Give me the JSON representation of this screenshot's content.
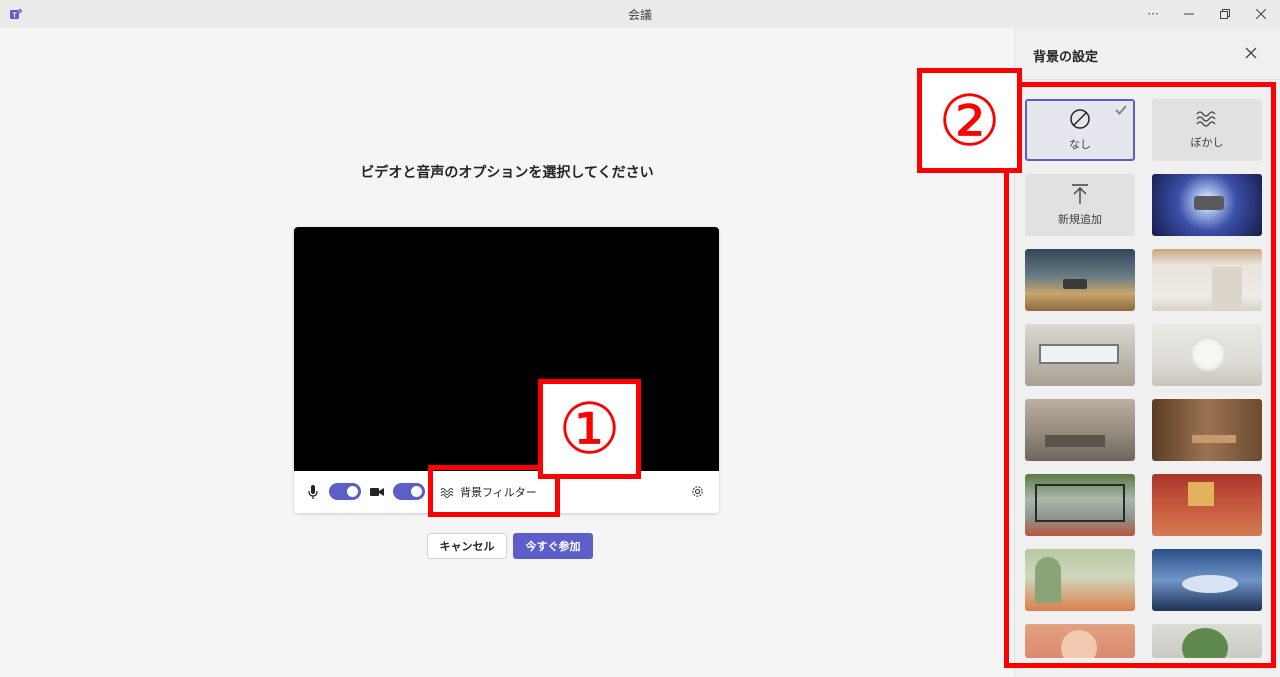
{
  "window": {
    "title": "会議",
    "more_label": "···"
  },
  "main": {
    "heading": "ビデオと音声のオプションを選択してください",
    "bg_filter_label": "背景フィルター",
    "mic_on": true,
    "camera_on": true,
    "cancel_label": "キャンセル",
    "join_label": "今すぐ参加"
  },
  "panel": {
    "title": "背景の設定",
    "options": [
      {
        "label": "なし",
        "icon": "none-circle-slash-icon",
        "selected": true
      },
      {
        "label": "ぼかし",
        "icon": "blur-icon",
        "selected": false
      },
      {
        "label": "新規追加",
        "icon": "upload-icon",
        "selected": false
      }
    ],
    "backgrounds": [
      "space-ship",
      "desert-planet",
      "minimal-room",
      "loft-living",
      "white-arch-room",
      "concrete-lounge",
      "wood-dining",
      "glass-garden",
      "red-interior",
      "green-arches",
      "blue-curves",
      "coral-arch",
      "green-circle"
    ]
  },
  "annotations": {
    "marker_1": "①",
    "marker_2": "②",
    "color": "#ff0000"
  },
  "colors": {
    "accent": "#5b5fc7"
  }
}
